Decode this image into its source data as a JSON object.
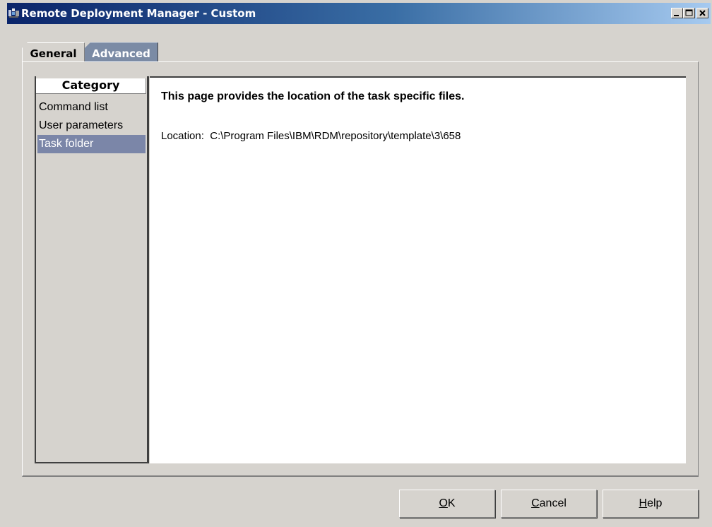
{
  "window": {
    "title": "Remote Deployment Manager - Custom",
    "titlebar_gradient": [
      "#0a246a",
      "#a6caf0"
    ]
  },
  "tabs": [
    {
      "label": "General",
      "selected": true
    },
    {
      "label": "Advanced",
      "selected": false
    }
  ],
  "category": {
    "header": "Category",
    "items": [
      {
        "label": "Command list",
        "selected": false
      },
      {
        "label": "User parameters",
        "selected": false
      },
      {
        "label": "Task folder",
        "selected": true
      }
    ]
  },
  "content": {
    "heading": "This page provides the location of the task specific files.",
    "location_label": "Location:",
    "location_value": "C:\\Program Files\\IBM\\RDM\\repository\\template\\3\\658"
  },
  "buttons": {
    "ok": {
      "mnemonic": "O",
      "rest": "K"
    },
    "cancel": {
      "mnemonic": "C",
      "rest": "ancel"
    },
    "help": {
      "mnemonic": "H",
      "rest": "elp"
    }
  },
  "icons": {
    "app": "app-icon",
    "minimize": "minimize-icon",
    "maximize": "maximize-icon",
    "close": "close-icon"
  },
  "colors": {
    "selection": "#7b86a8",
    "face": "#d6d3ce"
  }
}
